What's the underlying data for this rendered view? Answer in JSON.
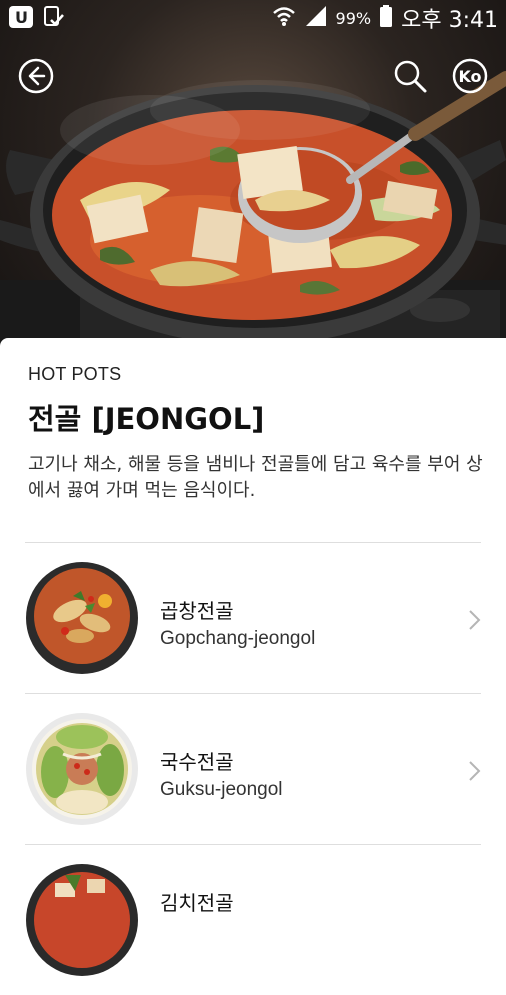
{
  "status": {
    "battery_text": "99%",
    "time": "오후 3:41",
    "icons": [
      "u-plus-app-icon",
      "download-done-icon",
      "wifi-icon",
      "signal-icon",
      "battery-icon"
    ]
  },
  "header": {
    "icons": [
      "back-arrow-icon",
      "search-icon",
      "ko-language-icon"
    ],
    "lang_label": "Ko"
  },
  "content": {
    "category": "HOT POTS",
    "title": "전골 [JEONGOL]",
    "description": "고기나 채소, 해물 등을 냄비나 전골틀에 담고 육수를 부어 상에서 끓여 가며 먹는 음식이다."
  },
  "dishes": [
    {
      "name_ko": "곱창전골",
      "name_en": "Gopchang-jeongol"
    },
    {
      "name_ko": "국수전골",
      "name_en": "Guksu-jeongol"
    },
    {
      "name_ko": "김치전골",
      "name_en": ""
    }
  ],
  "colors": {
    "broth": "#c8502a",
    "pot": "#2e2e2e",
    "divider": "#dedede",
    "chevron": "#b5b5b5"
  }
}
